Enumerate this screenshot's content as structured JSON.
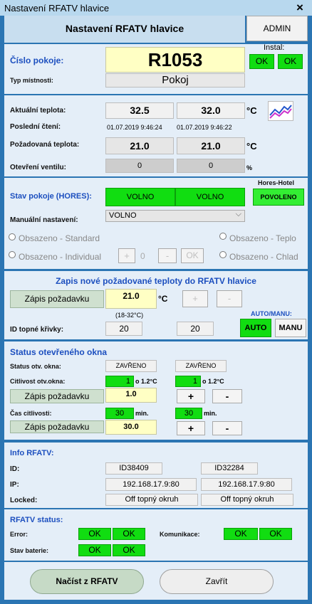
{
  "window": {
    "title": "Nastavení RFATV hlavice",
    "close_icon": "×"
  },
  "header": {
    "title": "Nastavení RFATV hlavice",
    "admin_tab": "ADMIN"
  },
  "room": {
    "number_label": "Číslo pokoje:",
    "number": "R1053",
    "type_label": "Typ místnosti:",
    "type": "Pokoj",
    "instal_label": "Instal:",
    "instal_1": "OK",
    "instal_2": "OK"
  },
  "temps": {
    "current_label": "Aktuální teplota:",
    "current_1": "32.5",
    "current_2": "32.0",
    "unit_c": "°C",
    "last_read_label": "Poslední čtení:",
    "last_read_1": "01.07.2019 9:46:24",
    "last_read_2": "01.07.2019 9:46:22",
    "requested_label": "Požadovaná teplota:",
    "requested_1": "21.0",
    "requested_2": "21.0",
    "valve_label": "Otevření ventilu:",
    "valve_1": "0",
    "valve_2": "0",
    "unit_pct": "%"
  },
  "room_status": {
    "hores_label": "Stav pokoje (HORES):",
    "status_1": "VOLNO",
    "status_2": "VOLNO",
    "hotel_label": "Hores-Hotel",
    "hotel_btn": "POVOLENO",
    "manual_label": "Manuální nastavení:",
    "manual_value": "VOLNO",
    "radio_std": "Obsazeno - Standard",
    "radio_ind": "Obsazeno - Individual",
    "radio_warm": "Obsazeno - Teplo",
    "radio_cold": "Obsazeno - Chlad",
    "plus": "+",
    "value": "0",
    "minus": "-",
    "ok": "OK"
  },
  "write_temp": {
    "title": "Zapis nové požadované teploty do RFATV hlavice",
    "button": "Zápis požadavku",
    "value": "21.0",
    "unit": "°C",
    "range": "(18-32°C)",
    "plus": "+",
    "minus": "-",
    "auto_manu_label": "AUTO/MANU:",
    "curve_label": "ID topné křivky:",
    "curve_1": "20",
    "curve_2": "20",
    "auto_btn": "AUTO",
    "manu_btn": "MANU"
  },
  "window_status": {
    "title": "Status otevřeného okna",
    "status_label": "Status otv. okna:",
    "status_1": "ZAVŘENO",
    "status_2": "ZAVŘENO",
    "sens_label": "Citlivost otv.okna:",
    "sens_1": "1",
    "sens_2": "1",
    "sens_unit": "o 1.2°C",
    "write_btn_1": "Zápis požadavku",
    "sens_input": "1.0",
    "plus": "+",
    "minus": "-",
    "time_label": "Čas citlivosti:",
    "time_1": "30",
    "time_2": "30",
    "time_unit": "min.",
    "write_btn_2": "Zápis požadavku",
    "time_input": "30.0"
  },
  "info": {
    "title": "Info RFATV:",
    "id_label": "ID:",
    "id_1": "ID38409",
    "id_2": "ID32284",
    "ip_label": "IP:",
    "ip_1": "192.168.17.9:80",
    "ip_2": "192.168.17.9:80",
    "locked_label": "Locked:",
    "locked_1": "Off topný okruh",
    "locked_2": "Off topný okruh"
  },
  "rfatv_status": {
    "title": "RFATV status:",
    "error_label": "Error:",
    "error_1": "OK",
    "error_2": "OK",
    "comm_label": "Komunikace:",
    "comm_1": "OK",
    "comm_2": "OK",
    "battery_label": "Stav baterie:",
    "battery_1": "OK",
    "battery_2": "OK"
  },
  "footer": {
    "load_btn": "Načíst z RFATV",
    "close_btn": "Zavřít"
  },
  "colors": {
    "frame": "#2b75b3",
    "ok_green": "#11dd11",
    "label_blue": "#1c4fbf",
    "input_yellow": "#ffffc4"
  }
}
